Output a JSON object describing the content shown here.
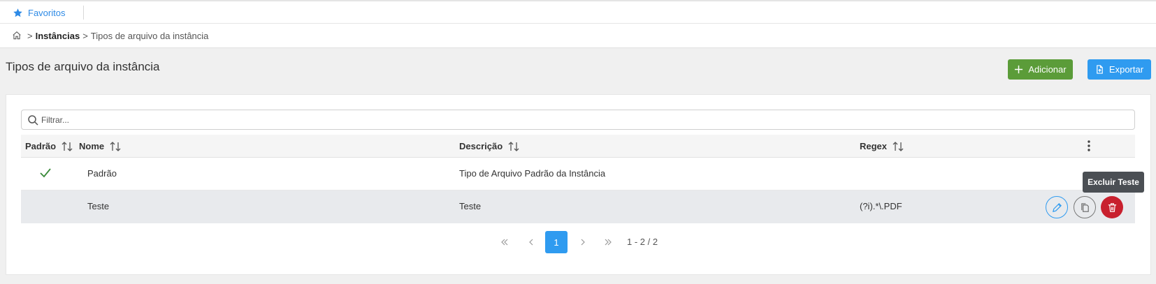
{
  "topbar": {
    "favorites_label": "Favoritos"
  },
  "breadcrumb": {
    "separator": ">",
    "parent": "Instâncias",
    "current": "Tipos de arquivo da instância"
  },
  "page": {
    "title": "Tipos de arquivo da instância"
  },
  "actions": {
    "add_label": "Adicionar",
    "export_label": "Exportar"
  },
  "filter": {
    "placeholder": "Filtrar...",
    "value": ""
  },
  "table": {
    "columns": [
      "Padrão",
      "Nome",
      "Descrição",
      "Regex"
    ],
    "rows": [
      {
        "default": true,
        "name": "Padrão",
        "description": "Tipo de Arquivo Padrão da Instância",
        "regex": ""
      },
      {
        "default": false,
        "name": "Teste",
        "description": "Teste",
        "regex": "(?i).*\\.PDF"
      }
    ]
  },
  "tooltip": {
    "text": "Excluir Teste"
  },
  "pagination": {
    "current_page": "1",
    "range_text": "1 - 2 / 2"
  },
  "colors": {
    "primary": "#2f9bf0",
    "success": "#5b9c39",
    "danger": "#c8202e",
    "check": "#3a8a3a"
  }
}
